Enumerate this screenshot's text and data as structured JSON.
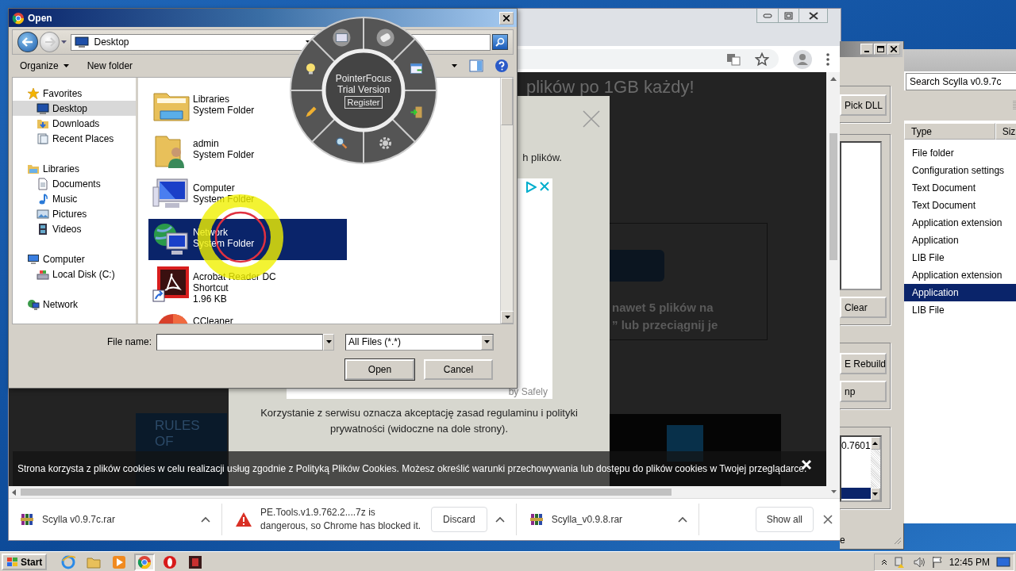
{
  "open_dialog": {
    "title": "Open",
    "address": "Desktop",
    "toolbar": [
      "Organize",
      "New folder"
    ],
    "nav": [
      {
        "label": "Favorites",
        "selected": false,
        "children": [
          {
            "label": "Desktop",
            "selected": true
          },
          {
            "label": "Downloads",
            "selected": false
          },
          {
            "label": "Recent Places",
            "selected": false
          }
        ]
      },
      {
        "label": "Libraries",
        "selected": false,
        "children": [
          {
            "label": "Documents",
            "selected": false
          },
          {
            "label": "Music",
            "selected": false
          },
          {
            "label": "Pictures",
            "selected": false
          },
          {
            "label": "Videos",
            "selected": false
          }
        ]
      },
      {
        "label": "Computer",
        "selected": false,
        "children": [
          {
            "label": "Local Disk (C:)",
            "selected": false
          }
        ]
      },
      {
        "label": "Network",
        "selected": false
      }
    ],
    "files": [
      {
        "name": "Libraries",
        "details": [
          "System Folder"
        ],
        "selected": false
      },
      {
        "name": "admin",
        "details": [
          "System Folder"
        ],
        "selected": false
      },
      {
        "name": "Computer",
        "details": [
          "System Folder"
        ],
        "selected": false
      },
      {
        "name": "Network",
        "details": [
          "System Folder"
        ],
        "selected": true
      },
      {
        "name": "Acrobat Reader DC",
        "details": [
          "Shortcut",
          "1.96 KB"
        ],
        "selected": false
      },
      {
        "name": "CCleaner",
        "selected": false
      }
    ],
    "file_name_label": "File name:",
    "filter": "All Files (*.*)",
    "buttons": [
      "Open",
      "Cancel"
    ]
  },
  "pointer_focus": {
    "title": "PointerFocus",
    "subtitle": "Trial Version",
    "button": "Register"
  },
  "browser": {
    "heading": "plików po 1GB każdy!",
    "modal": {
      "text": "h plików.",
      "ad_credit": "by Safely",
      "footer": "Korzystanie z serwisu oznacza akceptację zasad regulaminu i polityki prywatności (widoczne na dole strony)."
    },
    "upload_lines": [
      "nawet 5 plików na",
      "” lub przeciągnij je"
    ],
    "ad_text": "RULES OF",
    "cookie_notice": "Strona korzysta z plików cookies w celu realizacji usług zgodnie z Polityką Plików Cookies. Możesz określić warunki przechowywania lub dostępu do plików cookies w Twojej przeglądarce.",
    "downloads": [
      {
        "kind": "archive",
        "text": "Scylla v0.9.7c.rar"
      },
      {
        "kind": "blocked",
        "text": "PE.Tools.v1.9.762.2....7z is dangerous, so Chrome has blocked it.",
        "action": "Discard"
      },
      {
        "kind": "archive",
        "text": "Scylla_v0.9.8.rar"
      }
    ],
    "show_all": "Show all"
  },
  "scylla": {
    "buttons": [
      "Pick DLL",
      "Clear",
      "E Rebuild",
      "np"
    ],
    "log_value": "0.7601",
    "status": "e"
  },
  "search_window": {
    "query": "Search Scylla v0.9.7c",
    "columns": [
      "Type",
      "Siz"
    ],
    "rows": [
      {
        "type": "File folder",
        "selected": false
      },
      {
        "type": "Configuration settings",
        "selected": false
      },
      {
        "type": "Text Document",
        "selected": false
      },
      {
        "type": "Text Document",
        "selected": false
      },
      {
        "type": "Application extension",
        "selected": false
      },
      {
        "type": "Application",
        "selected": false
      },
      {
        "type": "LIB File",
        "selected": false
      },
      {
        "type": "Application extension",
        "selected": false
      },
      {
        "type": "Application",
        "selected": true
      },
      {
        "type": "LIB File",
        "selected": false
      }
    ]
  },
  "taskbar": {
    "start": "Start",
    "clock": "12:45 PM",
    "apps": [
      {
        "selected": false
      },
      {
        "selected": false
      },
      {
        "selected": false
      },
      {
        "selected": true
      },
      {
        "selected": false
      },
      {
        "selected": false
      }
    ]
  }
}
